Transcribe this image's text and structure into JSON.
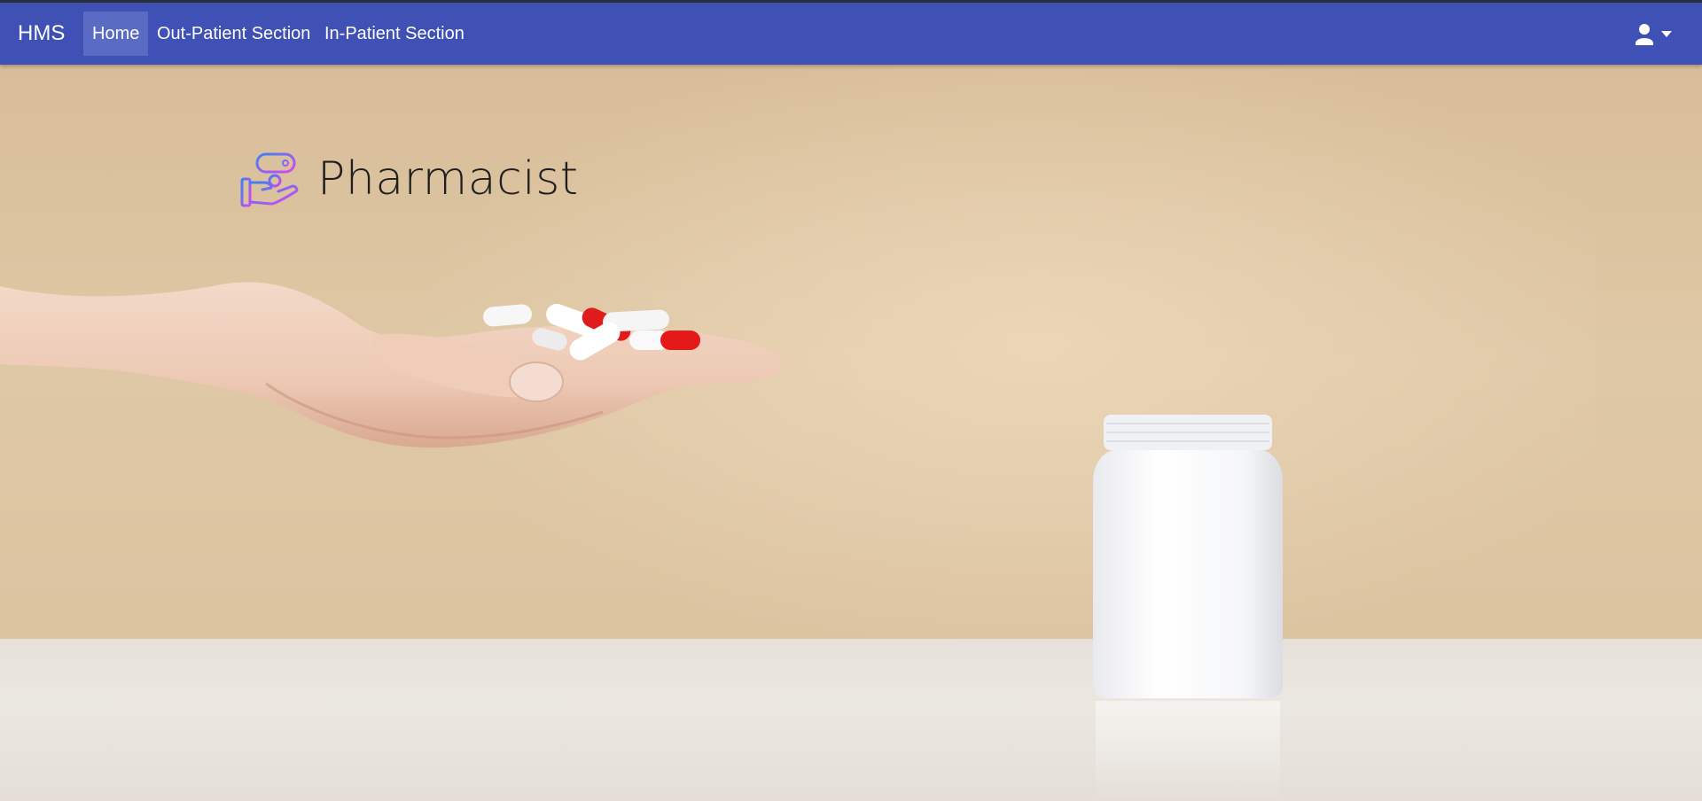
{
  "navbar": {
    "brand": "HMS",
    "links": [
      {
        "label": "Home",
        "active": true
      },
      {
        "label": "Out-Patient Section",
        "active": false
      },
      {
        "label": "In-Patient Section",
        "active": false
      }
    ],
    "user_menu": {
      "icon": "user-icon",
      "caret": "caret-down-icon"
    }
  },
  "hero": {
    "title": "Pharmacist",
    "title_icon": "hand-holding-medicine-icon",
    "background_image": "hand-holding-pills-with-white-bottle"
  },
  "colors": {
    "navbar_bg": "#3f51b5",
    "nav_active_bg": "#5a6bc4",
    "nav_text": "#ffffff",
    "hero_wall": "#dfc8a6",
    "hero_table": "#ebe7e1",
    "icon_gradient_start": "#3b82f6",
    "icon_gradient_end": "#d946ef"
  }
}
